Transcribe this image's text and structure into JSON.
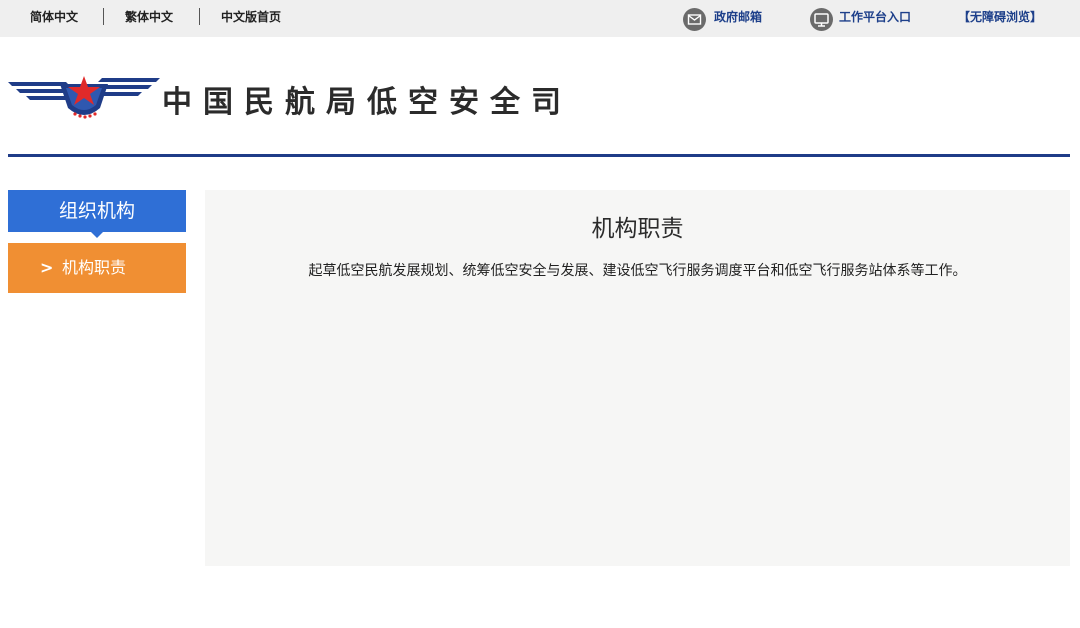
{
  "topbar": {
    "simplified": "简体中文",
    "traditional": "繁体中文",
    "chinese_home": "中文版首页",
    "gov_mail": "政府邮箱",
    "work_platform": "工作平台入口",
    "accessibility": "【无障碍浏览】"
  },
  "header": {
    "org_name": "中国民航局低空安全司"
  },
  "sidebar": {
    "heading": "组织机构",
    "items": [
      {
        "chevron": ">",
        "label": "机构职责"
      }
    ]
  },
  "main": {
    "title": "机构职责",
    "body": "起草低空民航发展规划、统筹低空安全与发展、建设低空飞行服务调度平台和低空飞行服务站体系等工作。"
  },
  "colors": {
    "brand_blue": "#1f3c88",
    "sidebar_blue": "#2f6fd6",
    "active_orange": "#f08f33",
    "logo_red": "#e02a2a"
  }
}
